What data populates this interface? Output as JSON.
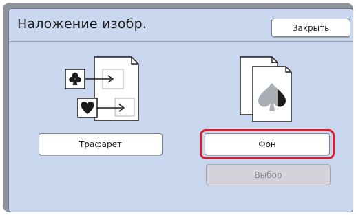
{
  "header": {
    "title": "Наложение изобр.",
    "close_label": "Закрыть"
  },
  "options": {
    "stencil_label": "Трафарет",
    "background_label": "Фон",
    "select_label": "Выбор"
  },
  "state": {
    "selected_option": "Фон",
    "select_button_enabled": false
  },
  "icons": {
    "stencil_illustration": "overlay-stencil-icon",
    "background_illustration": "overlay-background-icon"
  },
  "colors": {
    "panel_background": "#c9d7ee",
    "selection_outline": "#d61f2e",
    "disabled_button": "#d6d2dc"
  }
}
